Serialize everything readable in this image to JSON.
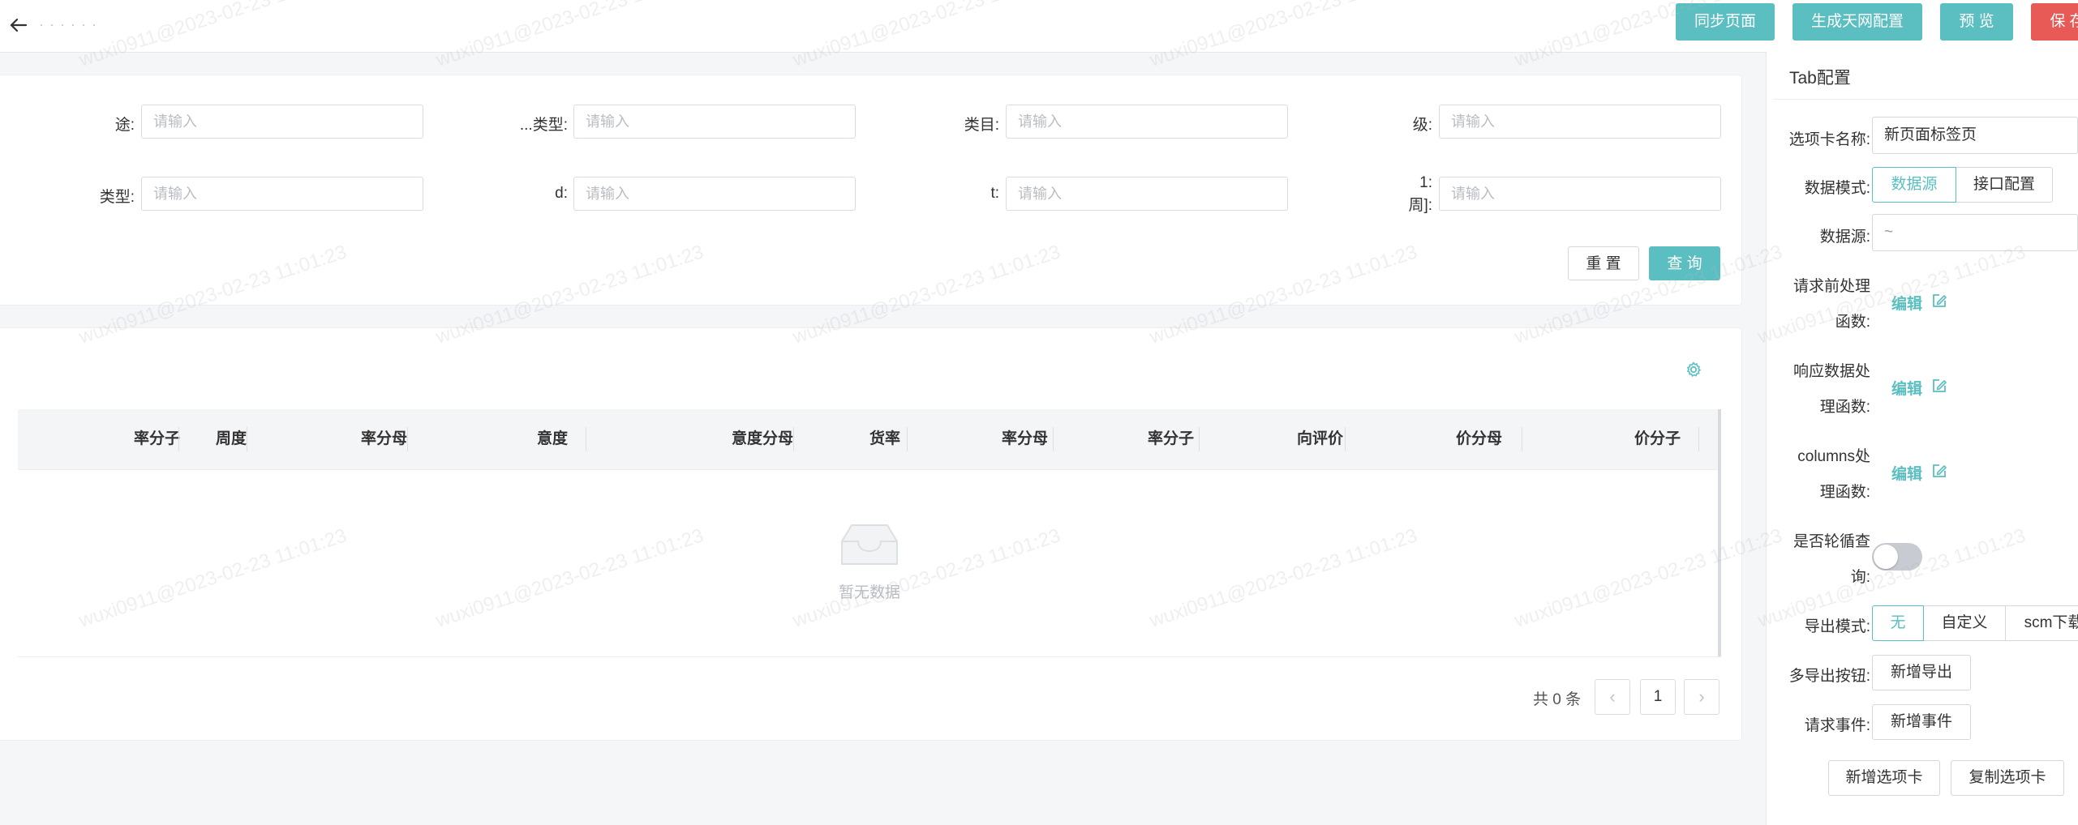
{
  "header": {
    "page_name": "· · ·  · · ·",
    "buttons": {
      "sync": "同步页面",
      "generate": "生成天网配置",
      "preview": "预 览",
      "save": "保 存"
    }
  },
  "filters": {
    "placeholder": "请输入",
    "labels": [
      "途:",
      "...类型:",
      "类目:",
      "级:",
      "类型:",
      "d:",
      "t:",
      "1:\n周]:"
    ],
    "reset": "重 置",
    "search": "查 询"
  },
  "table": {
    "columns": [
      "率分子",
      "周度",
      "率分母",
      "意度",
      "意度分母",
      "货率",
      "率分母",
      "率分子",
      "向评价",
      "价分母",
      "价分子"
    ],
    "empty_text": "暂无数据"
  },
  "pagination": {
    "total": "共 0 条",
    "current_page": "1"
  },
  "panel": {
    "title": "Tab配置",
    "tab_name_label": "选项卡名称:",
    "tab_name_value": "新页面标签页",
    "data_mode_label": "数据模式:",
    "data_mode_options": [
      "数据源",
      "接口配置"
    ],
    "data_source_label": "数据源:",
    "data_source_value": "~",
    "pre_request_label_1": "请求前处理",
    "pre_request_label_2": "函数:",
    "response_label_1": "响应数据处",
    "response_label_2": "理函数:",
    "columns_label_1": "columns处",
    "columns_label_2": "理函数:",
    "edit": "编辑",
    "polling_label_1": "是否轮循查",
    "polling_label_2": "询:",
    "export_mode_label": "导出模式:",
    "export_mode_options": [
      "无",
      "自定义",
      "scm下载"
    ],
    "multi_export_label": "多导出按钮:",
    "add_export": "新增导出",
    "request_event_label": "请求事件:",
    "add_event": "新增事件",
    "add_tab": "新增选项卡",
    "copy_tab": "复制选项卡"
  },
  "watermark": "wuxi0911@2023-02-23 11:01:23"
}
